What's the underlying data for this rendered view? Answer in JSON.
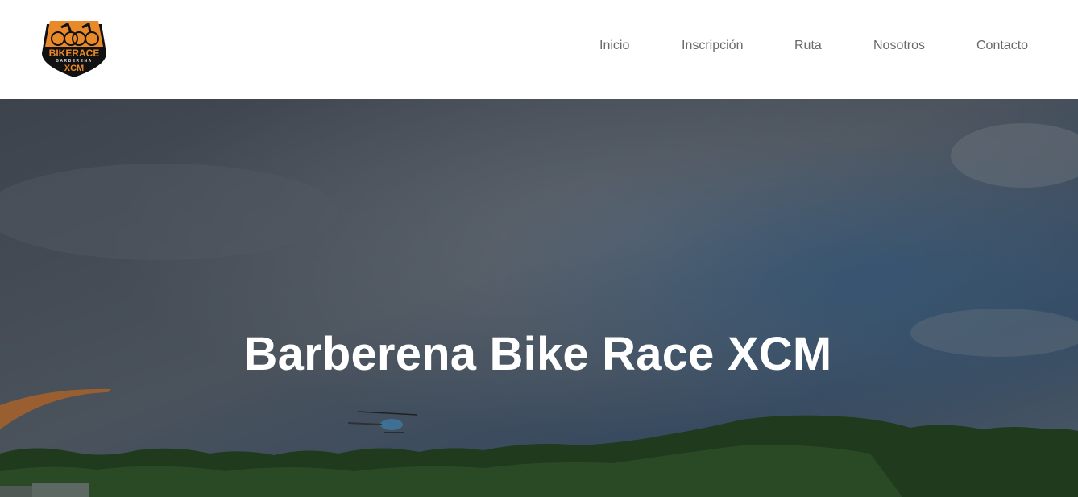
{
  "logo": {
    "text_main": "BIKERACE",
    "text_sub": "BARBERENA",
    "text_tag": "XCM"
  },
  "nav": {
    "items": [
      {
        "label": "Inicio"
      },
      {
        "label": "Inscripción"
      },
      {
        "label": "Ruta"
      },
      {
        "label": "Nosotros"
      },
      {
        "label": "Contacto"
      }
    ]
  },
  "hero": {
    "title": "Barberena Bike Race XCM"
  },
  "colors": {
    "nav_text": "#6a6a6a",
    "logo_orange": "#e8892a",
    "hero_overlay": "#3a3f47"
  }
}
